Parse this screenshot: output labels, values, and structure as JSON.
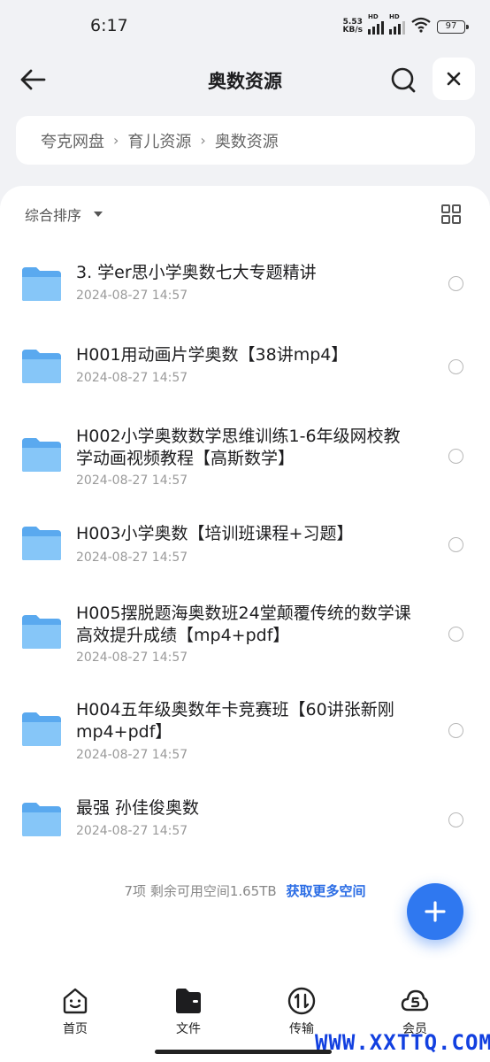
{
  "status_bar": {
    "time": "6:17",
    "net_speed": "5.53",
    "net_unit": "KB/s",
    "hd1": "HD",
    "hd2": "HD",
    "battery": "97"
  },
  "header": {
    "title": "奥数资源",
    "back_icon": "arrow-left-icon",
    "search_icon": "search-icon",
    "close_icon": "close-icon"
  },
  "breadcrumb": [
    "夸克网盘",
    "育儿资源",
    "奥数资源"
  ],
  "toolbar": {
    "sort_label": "综合排序",
    "view_icon": "grid-view-icon"
  },
  "files": [
    {
      "name": "3. 学er思小学奥数七大专题精讲",
      "date": "2024-08-27 14:57"
    },
    {
      "name": "H001用动画片学奥数【38讲mp4】",
      "date": "2024-08-27 14:57"
    },
    {
      "name": "H002小学奥数数学思维训练1-6年级网校教学动画视频教程【高斯数学】",
      "date": "2024-08-27 14:57"
    },
    {
      "name": "H003小学奥数【培训班课程+习题】",
      "date": "2024-08-27 14:57"
    },
    {
      "name": "H005摆脱题海奥数班24堂颠覆传统的数学课高效提升成绩【mp4+pdf】",
      "date": "2024-08-27 14:57"
    },
    {
      "name": "H004五年级奥数年卡竞赛班【60讲张新刚mp4+pdf】",
      "date": "2024-08-27 14:57"
    },
    {
      "name": "最强 孙佳俊奥数",
      "date": "2024-08-27 14:57"
    }
  ],
  "footer": {
    "summary": "7项 剩余可用空间1.65TB",
    "more_space": "获取更多空间"
  },
  "fab_icon": "plus-icon",
  "tabs": [
    {
      "label": "首页",
      "icon": "home-face-icon"
    },
    {
      "label": "文件",
      "icon": "folder-file-icon"
    },
    {
      "label": "传输",
      "icon": "transfer-icon"
    },
    {
      "label": "会员",
      "icon": "member-icon"
    }
  ],
  "watermark": "WWW.XXTTQ.COM",
  "colors": {
    "accent": "#2f78f0",
    "link": "#2b6de5",
    "folder": "#6cb7f5",
    "background": "#f1f2f5"
  }
}
